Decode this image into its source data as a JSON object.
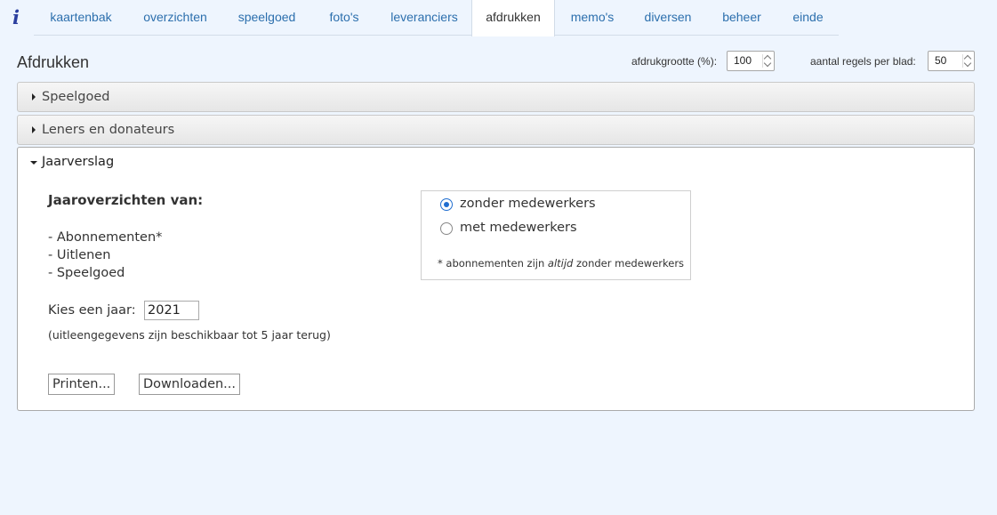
{
  "app": {
    "logo_glyph": "i"
  },
  "nav": {
    "tabs": [
      {
        "label": "kaartenbak"
      },
      {
        "label": "overzichten"
      },
      {
        "label": "speelgoed"
      },
      {
        "label": "foto's"
      },
      {
        "label": "leveranciers"
      },
      {
        "label": "afdrukken",
        "active": true
      },
      {
        "label": "memo's"
      },
      {
        "label": "diversen"
      },
      {
        "label": "beheer"
      },
      {
        "label": "einde"
      }
    ]
  },
  "header": {
    "title": "Afdrukken",
    "print_size_label": "afdrukgrootte (%):",
    "print_size_value": "100",
    "lines_per_page_label": "aantal regels per blad:",
    "lines_per_page_value": "50"
  },
  "accordion": {
    "sections": [
      {
        "label": "Speelgoed",
        "expanded": false
      },
      {
        "label": "Leners en donateurs",
        "expanded": false
      },
      {
        "label": "Jaarverslag",
        "expanded": true
      }
    ]
  },
  "jaarverslag": {
    "heading": "Jaaroverzichten van:",
    "items": [
      "- Abonnementen*",
      "- Uitlenen",
      "- Speelgoed"
    ],
    "year_label": "Kies een jaar:",
    "year_value": "2021",
    "year_note": "(uitleengegevens zijn beschikbaar tot 5 jaar terug)",
    "print_button": "Printen...",
    "download_button": "Downloaden...",
    "options": [
      {
        "label": "zonder medewerkers",
        "checked": true
      },
      {
        "label": "met medewerkers",
        "checked": false
      }
    ],
    "footnote_prefix": "* abonnementen zijn ",
    "footnote_emphasis": "altijd",
    "footnote_suffix": " zonder medewerkers"
  },
  "colors": {
    "background": "#eef5fe",
    "link": "#2c6fad",
    "radio_accent": "#1f6dd0"
  }
}
